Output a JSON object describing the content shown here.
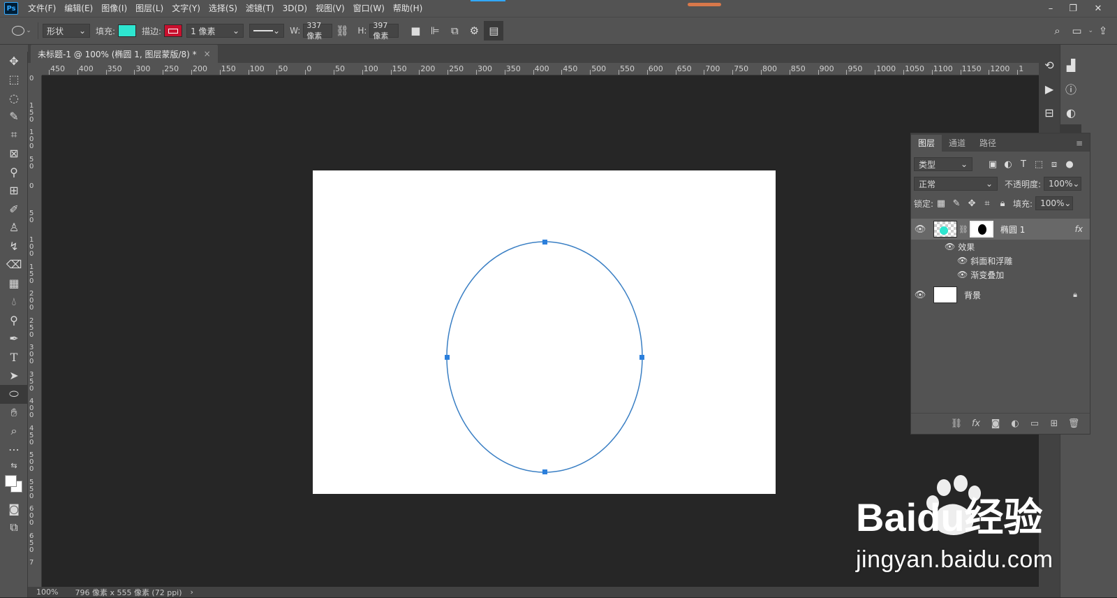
{
  "app": {
    "logo": "Ps"
  },
  "menu": [
    "文件(F)",
    "编辑(E)",
    "图像(I)",
    "图层(L)",
    "文字(Y)",
    "选择(S)",
    "滤镜(T)",
    "3D(D)",
    "视图(V)",
    "窗口(W)",
    "帮助(H)"
  ],
  "window_controls": {
    "minimize": "–",
    "restore": "❐",
    "close": "✕"
  },
  "options": {
    "mode": "形状",
    "fill_label": "填充:",
    "fill_color": "#2ee6d0",
    "stroke_label": "描边:",
    "stroke_color": "#c8102e",
    "stroke_width": "1 像素",
    "w_label": "W:",
    "w_value": "337 像素",
    "h_label": "H:",
    "h_value": "397 像素"
  },
  "document": {
    "tab_title": "未标题-1 @ 100% (椭圆 1, 图层蒙版/8) *",
    "close": "×",
    "bg_color": "#ffffff"
  },
  "ruler": {
    "h_labels": [
      "450",
      "400",
      "350",
      "300",
      "250",
      "200",
      "150",
      "100",
      "50",
      "0",
      "50",
      "100",
      "150",
      "200",
      "250",
      "300",
      "350",
      "400",
      "450",
      "500",
      "550",
      "600",
      "650",
      "700",
      "750",
      "800",
      "850",
      "900",
      "950",
      "1000",
      "1050",
      "1100",
      "1150",
      "1200",
      "1"
    ],
    "v_labels": [
      "0",
      "1\n5\n0",
      "1\n0\n0",
      "5\n0",
      "0",
      "5\n0",
      "1\n0\n0",
      "1\n5\n0",
      "2\n0\n0",
      "2\n5\n0",
      "3\n0\n0",
      "3\n5\n0",
      "4\n0\n0",
      "4\n5\n0",
      "5\n0\n0",
      "5\n5\n0",
      "6\n0\n0",
      "6\n5\n0",
      "7"
    ]
  },
  "status": {
    "zoom": "100%",
    "doc_size": "796 像素 x 555 像素 (72 ppi)",
    "arrow": "›"
  },
  "layers_panel": {
    "tabs": [
      "图层",
      "通道",
      "路径"
    ],
    "filter_label": "类型",
    "blend_mode": "正常",
    "opacity_label": "不透明度:",
    "opacity_value": "100%",
    "lock_label": "锁定:",
    "fill_label": "填充:",
    "fill_value": "100%",
    "layers": [
      {
        "name": "椭圆 1",
        "fx": "fx",
        "effects_label": "效果",
        "effects": [
          "斜面和浮雕",
          "渐变叠加"
        ]
      },
      {
        "name": "背景"
      }
    ]
  },
  "shape": {
    "stroke_color": "#3a7fc4",
    "handle_color": "#2b7fdc"
  },
  "watermark": {
    "brand": "Baidu经验",
    "url": "jingyan.baidu.com"
  }
}
